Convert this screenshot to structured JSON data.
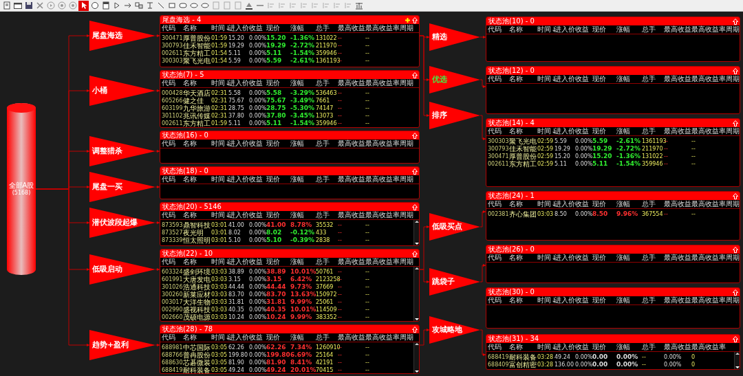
{
  "toolbar": {
    "tools": [
      {
        "kind": "new",
        "selected": false
      },
      {
        "kind": "window",
        "selected": false
      },
      {
        "kind": "save",
        "selected": false
      },
      {
        "kind": "cut",
        "selected": false
      },
      {
        "kind": "play",
        "selected": false
      },
      {
        "kind": "record",
        "selected": false
      },
      {
        "kind": "record",
        "selected": false
      },
      {
        "kind": "pointer",
        "selected": true
      },
      {
        "kind": "ellipse",
        "selected": false
      },
      {
        "kind": "panel",
        "selected": false
      },
      {
        "kind": "triangle",
        "selected": false
      },
      {
        "kind": "arrow",
        "selected": false
      },
      {
        "kind": "link",
        "selected": false
      },
      {
        "kind": "text",
        "selected": false
      },
      {
        "kind": "line",
        "selected": false
      },
      {
        "kind": "rect",
        "selected": false
      },
      {
        "kind": "round",
        "selected": false
      },
      {
        "kind": "oval",
        "selected": false
      },
      {
        "kind": "oval",
        "selected": false
      },
      {
        "kind": "page",
        "selected": false
      },
      {
        "kind": "page",
        "selected": false
      },
      {
        "kind": "page",
        "selected": false
      },
      {
        "kind": "paint",
        "selected": false
      },
      {
        "kind": "hline",
        "selected": false
      },
      {
        "kind": "align",
        "selected": false
      },
      {
        "kind": "align",
        "selected": false
      },
      {
        "kind": "align",
        "selected": false
      },
      {
        "kind": "align",
        "selected": false
      },
      {
        "kind": "align",
        "selected": false
      },
      {
        "kind": "align",
        "selected": false
      },
      {
        "kind": "align",
        "selected": false
      },
      {
        "kind": "align",
        "selected": false
      },
      {
        "kind": "chart",
        "selected": false
      }
    ]
  },
  "source": {
    "label": "全部A股",
    "count": "(5168)"
  },
  "stages": [
    {
      "label": "尾盘海选",
      "color": "#ffffff",
      "pool": {
        "title": "尾盘海选 - 4",
        "add_icon": true,
        "columns": [
          "代码",
          "名称",
          "时间↓",
          "进入价",
          "收益",
          "现价",
          "涨幅",
          "总手",
          "最高收益",
          "最高收益率周期"
        ],
        "rows": [
          {
            "cells": [
              "300471",
              "厚普股份",
              "01:59",
              "15.20",
              "0.00%",
              "15.20",
              "-1.36%",
              "131022",
              "--",
              "--"
            ],
            "color": "#30ee30"
          },
          {
            "cells": [
              "300793",
              "佳禾智能",
              "01:59",
              "19.29",
              "0.00%",
              "19.29",
              "-2.72%",
              "211970",
              "--",
              "--"
            ],
            "color": "#30ee30"
          },
          {
            "cells": [
              "002611",
              "东方精工",
              "01:54",
              "5.11",
              "0.00%",
              "5.11",
              "-1.54%",
              "359946",
              "--",
              "--"
            ],
            "color": "#30ee30"
          },
          {
            "cells": [
              "300303",
              "聚飞光电",
              "01:54",
              "5.59",
              "0.00%",
              "5.59",
              "-2.61%",
              "1361193",
              "--",
              "--"
            ],
            "color": "#30ee30"
          }
        ]
      }
    },
    {
      "label": "小桶",
      "color": "#ffffff",
      "pool": {
        "title": "状态池(7) - 5",
        "columns": [
          "代码",
          "名称",
          "时间↓",
          "进入价",
          "收益",
          "现价",
          "涨幅",
          "总手",
          "最高收益",
          "最高收益率周期"
        ],
        "rows": [
          {
            "cells": [
              "000428",
              "华天酒店",
              "02:31",
              "5.58",
              "0.00%",
              "5.58",
              "-3.29%",
              "536463",
              "--",
              "--"
            ],
            "color": "#30ee30"
          },
          {
            "cells": [
              "605266",
              "健之佳",
              "02:31",
              "75.67",
              "0.00%",
              "75.67",
              "-3.49%",
              "7661",
              "--",
              "--"
            ],
            "color": "#30ee30"
          },
          {
            "cells": [
              "603199",
              "九华旅游",
              "02:31",
              "28.75",
              "0.00%",
              "28.75",
              "-5.30%",
              "74147",
              "--",
              "--"
            ],
            "color": "#30ee30"
          },
          {
            "cells": [
              "301102",
              "兆讯传媒",
              "02:31",
              "37.80",
              "0.00%",
              "37.80",
              "-3.45%",
              "13073",
              "--",
              "--"
            ],
            "color": "#30ee30"
          },
          {
            "cells": [
              "002611",
              "东方精工",
              "01:59",
              "5.11",
              "0.00%",
              "5.11",
              "-1.54%",
              "359946",
              "--",
              "--"
            ],
            "color": "#30ee30"
          }
        ]
      }
    },
    {
      "label": "调整猎杀",
      "color": "#ffffff",
      "pool": {
        "title": "状态池(16) - 0",
        "columns": [
          "代码",
          "名称",
          "时间↓",
          "进入价",
          "收益",
          "现价",
          "涨幅",
          "总手",
          "最高收益",
          "最高收益率周期"
        ]
      }
    },
    {
      "label": "尾盘一买",
      "color": "#ffffff",
      "pool": {
        "title": "状态池(18) - 0",
        "columns": [
          "代码",
          "名称",
          "时间↓",
          "进入价",
          "收益",
          "现价",
          "涨幅",
          "总手",
          "最高收益",
          "最高收益率周期"
        ]
      }
    },
    {
      "label": "潜伏波段起爆",
      "color": "#ffffff",
      "pool": {
        "title": "状态池(20) - 5146",
        "scrollable": true,
        "columns": [
          "代码",
          "名称",
          "时间↓",
          "进入价",
          "收益",
          "现价",
          "涨幅",
          "总手",
          "最高收益",
          "最高收益率周期"
        ],
        "rows": [
          {
            "cells": [
              "873593",
              "鼎智科技",
              "03:01",
              "41.00",
              "0.00%",
              "41.00",
              "8.78%",
              "35532",
              "--",
              "--"
            ],
            "color": "#ff3030"
          },
          {
            "cells": [
              "873527",
              "夜光明",
              "03:01",
              "8.02",
              "0.00%",
              "8.02",
              "-0.12%",
              "433",
              "--",
              "--"
            ],
            "color": "#30ee30"
          },
          {
            "cells": [
              "873339",
              "恒太照明",
              "03:01",
              "5.10",
              "0.00%",
              "5.10",
              "-0.39%",
              "2838",
              "--",
              "--"
            ],
            "color": "#30ee30"
          }
        ]
      }
    },
    {
      "label": "低吸启动",
      "color": "#ffffff",
      "pool": {
        "title": "状态池(22) - 10",
        "scrollable": true,
        "columns": [
          "代码",
          "名称",
          "时间↓",
          "进入价",
          "收益",
          "现价",
          "涨幅",
          "总手",
          "最高收益",
          "最高收益率周期"
        ],
        "rows": [
          {
            "cells": [
              "603324",
              "盛剑环境",
              "03:03",
              "38.89",
              "0.00%",
              "38.89",
              "10.01%",
              "50761",
              "--",
              "--"
            ],
            "color": "#ff3030"
          },
          {
            "cells": [
              "601991",
              "大唐发电",
              "03:03",
              "3.15",
              "0.00%",
              "3.15",
              "6.42%",
              "2123258",
              "--",
              "--"
            ],
            "color": "#ff3030"
          },
          {
            "cells": [
              "301026",
              "浩通科技",
              "03:03",
              "44.44",
              "0.00%",
              "44.44",
              "9.73%",
              "37669",
              "--",
              "--"
            ],
            "color": "#ff3030"
          },
          {
            "cells": [
              "300260",
              "新莱应材",
              "03:03",
              "83.70",
              "0.00%",
              "83.70",
              "13.63%",
              "150972",
              "--",
              "--"
            ],
            "color": "#ff3030"
          },
          {
            "cells": [
              "003017",
              "大洋生物",
              "03:03",
              "31.81",
              "0.00%",
              "31.81",
              "9.99%",
              "25061",
              "--",
              "--"
            ],
            "color": "#ff3030"
          },
          {
            "cells": [
              "002990",
              "盛视科技",
              "03:03",
              "40.35",
              "0.00%",
              "40.35",
              "10.01%",
              "114509",
              "--",
              "--"
            ],
            "color": "#ff3030"
          },
          {
            "cells": [
              "002660",
              "茂硕电源",
              "03:03",
              "10.24",
              "0.00%",
              "10.24",
              "9.99%",
              "383352",
              "--",
              "--"
            ],
            "color": "#ff3030"
          }
        ]
      }
    },
    {
      "label": "趋势+盈利",
      "color": "#ffffff",
      "pool": {
        "title": "状态池(28) - 78",
        "scrollable": true,
        "columns": [
          "代码",
          "名称",
          "时间↓",
          "进入价",
          "收益",
          "现价",
          "涨幅",
          "总手",
          "最高收益",
          "最高收益率周期"
        ],
        "rows": [
          {
            "cells": [
              "688981",
              "中芯国际",
              "03:05",
              "62.26",
              "0.00%",
              "62.26",
              "7.34%",
              "1260910",
              "--",
              "--"
            ],
            "color": "#ff3030"
          },
          {
            "cells": [
              "688766",
              "普冉股份",
              "03:05",
              "199.80",
              "0.00%",
              "199.80",
              "6.69%",
              "25164",
              "--",
              "--"
            ],
            "color": "#ff3030"
          },
          {
            "cells": [
              "688630",
              "芯碁微装",
              "03:05",
              "81.90",
              "0.00%",
              "81.90",
              "8.41%",
              "42191",
              "--",
              "--"
            ],
            "color": "#ff3030"
          },
          {
            "cells": [
              "688419",
              "耐科装备",
              "03:05",
              "49.24",
              "0.00%",
              "49.24",
              "20.01%",
              "70415",
              "--",
              "--"
            ],
            "color": "#ff3030"
          }
        ]
      }
    }
  ],
  "sub_stages": [
    {
      "label": "精选",
      "color": "#ffffff",
      "pool": {
        "title": "状态池(10) - 0",
        "columns": [
          "代码",
          "名称",
          "时间↓",
          "进入价",
          "收益",
          "现价",
          "涨幅",
          "总手",
          "最高收益",
          "最高收益率周期"
        ]
      }
    },
    {
      "label": "优选",
      "color": "#44ee44",
      "pool": {
        "title": "状态池(12) - 0",
        "columns": [
          "代码",
          "名称",
          "时间↓",
          "进入价",
          "收益",
          "现价",
          "涨幅",
          "总手",
          "最高收益",
          "最高收益率周期"
        ]
      }
    },
    {
      "label": "排序",
      "color": "#ffffff",
      "pool": {
        "title": "状态池(14) - 4",
        "columns": [
          "代码",
          "名称",
          "时间↓",
          "进入价",
          "收益",
          "现价",
          "涨幅",
          "总手",
          "最高收益",
          "最高收益率周期"
        ],
        "rows": [
          {
            "cells": [
              "300303",
              "聚飞光电",
              "02:59",
              "5.59",
              "0.00%",
              "5.59",
              "-2.61%",
              "1361193",
              "--",
              "--"
            ],
            "color": "#30ee30"
          },
          {
            "cells": [
              "300793",
              "佳禾智能",
              "02:59",
              "19.29",
              "0.00%",
              "19.29",
              "-2.72%",
              "211970",
              "--",
              "--"
            ],
            "color": "#30ee30"
          },
          {
            "cells": [
              "300471",
              "厚普股份",
              "02:59",
              "15.20",
              "0.00%",
              "15.20",
              "-1.36%",
              "131022",
              "--",
              "--"
            ],
            "color": "#30ee30"
          },
          {
            "cells": [
              "002611",
              "东方精工",
              "02:59",
              "5.11",
              "0.00%",
              "5.11",
              "-1.54%",
              "359946",
              "--",
              "--"
            ],
            "color": "#30ee30"
          }
        ]
      }
    },
    {
      "label": "低吸买点",
      "color": "#ffffff",
      "pool": {
        "title": "状态池(24) - 1",
        "columns": [
          "代码",
          "名称",
          "时间↓",
          "进入价",
          "收益",
          "现价",
          "涨幅",
          "总手",
          "最高收益",
          "最高收益率周期"
        ],
        "rows": [
          {
            "cells": [
              "002381",
              "齐心集团",
              "03:03",
              "8.50",
              "0.00%",
              "8.50",
              "9.96%",
              "367554",
              "--",
              "--"
            ],
            "color": "#ff3030"
          }
        ]
      }
    },
    {
      "label": "跳袋子",
      "color": "#ffffff",
      "pool": {
        "title": "状态池(26) - 0",
        "columns": [
          "代码",
          "名称",
          "时间↓",
          "进入价",
          "收益",
          "现价",
          "涨幅",
          "总手",
          "最高收益",
          "最高收益率周期"
        ]
      }
    },
    {
      "label": "攻城略地",
      "color": "#ffffff",
      "pool": {
        "title": "状态池(31) - 34",
        "scrollable": true,
        "columns": [
          "代码",
          "名称",
          "时间↓",
          "进入价",
          "收益",
          "现价",
          "涨幅",
          "总手",
          "最高收益",
          "最高收益率"
        ],
        "rows": [
          {
            "cells": [
              "688419",
              "耐科装备",
              "03:28",
              "49.24",
              "0.00%",
              "0.00",
              "0.00%",
              "--",
              "0.00%",
              "0"
            ],
            "color": "#dddddd"
          },
          {
            "cells": [
              "688409",
              "富创精密",
              "03:28",
              "136.00",
              "0.00%",
              "0.00",
              "0.00%",
              "--",
              "0.00%",
              "0"
            ],
            "color": "#dddddd"
          }
        ]
      }
    }
  ],
  "unlinked_pools": [
    {
      "title": "状态池(30) - 0",
      "columns": [
        "代码",
        "名称",
        "时间↓",
        "进入价",
        "收益",
        "现价",
        "涨幅",
        "总手",
        "最高收益",
        "最高收益率周期"
      ]
    }
  ]
}
